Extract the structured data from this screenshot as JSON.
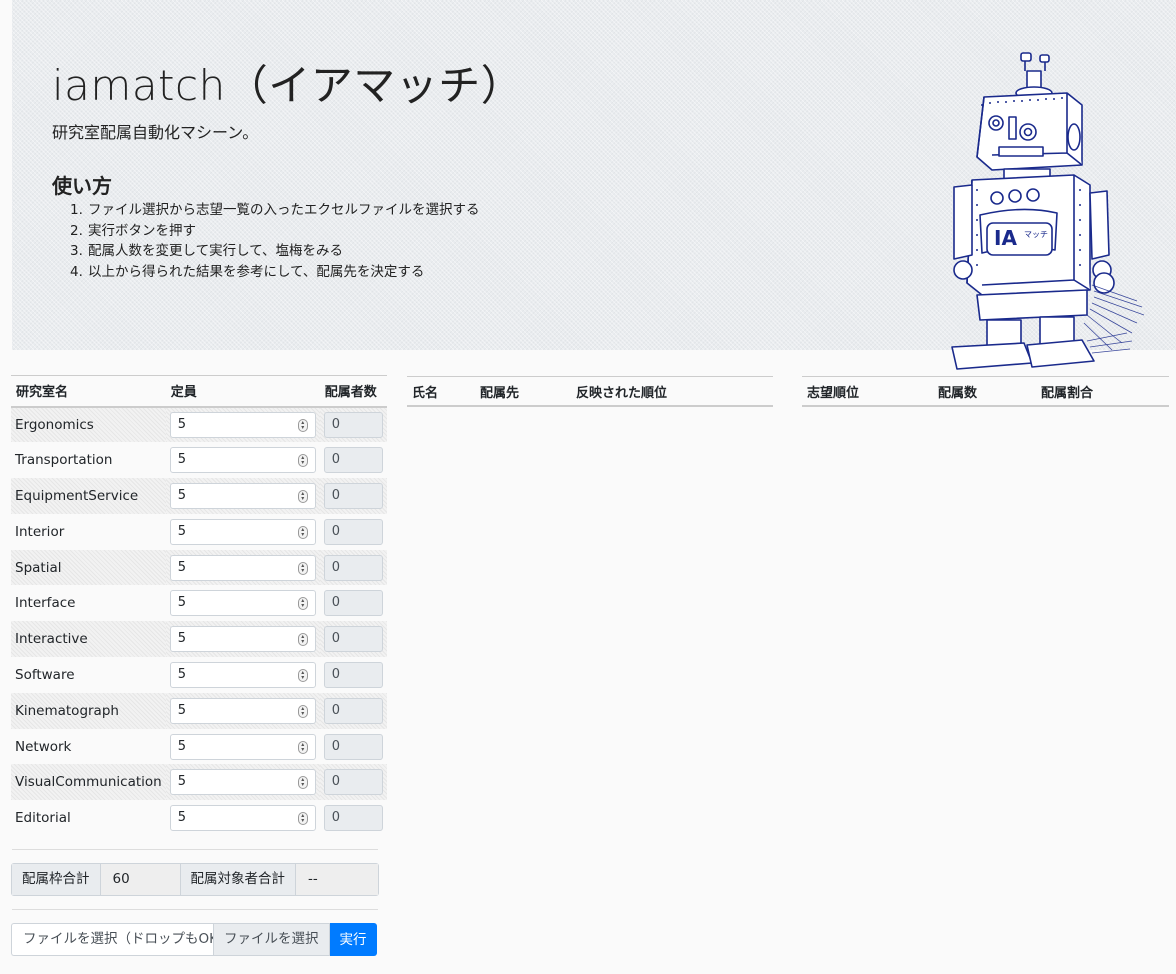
{
  "hero": {
    "title": "iamatch（イアマッチ）",
    "lead": "研究室配属自動化マシーン。",
    "howto_title": "使い方",
    "steps": [
      "ファイル選択から志望一覧の入ったエクセルファイルを選択する",
      "実行ボタンを押す",
      "配属人数を変更して実行して、塩梅をみる",
      "以上から得られた結果を参考にして、配属先を決定する"
    ],
    "robot_badge": "IA",
    "robot_badge_kana": "マッチ"
  },
  "labs_table": {
    "headers": [
      "研究室名",
      "定員",
      "配属者数"
    ],
    "rows": [
      {
        "name": "Ergonomics",
        "capacity": "5",
        "assigned": "0"
      },
      {
        "name": "Transportation",
        "capacity": "5",
        "assigned": "0"
      },
      {
        "name": "EquipmentService",
        "capacity": "5",
        "assigned": "0"
      },
      {
        "name": "Interior",
        "capacity": "5",
        "assigned": "0"
      },
      {
        "name": "Spatial",
        "capacity": "5",
        "assigned": "0"
      },
      {
        "name": "Interface",
        "capacity": "5",
        "assigned": "0"
      },
      {
        "name": "Interactive",
        "capacity": "5",
        "assigned": "0"
      },
      {
        "name": "Software",
        "capacity": "5",
        "assigned": "0"
      },
      {
        "name": "Kinematograph",
        "capacity": "5",
        "assigned": "0"
      },
      {
        "name": "Network",
        "capacity": "5",
        "assigned": "0"
      },
      {
        "name": "VisualCommunication",
        "capacity": "5",
        "assigned": "0"
      },
      {
        "name": "Editorial",
        "capacity": "5",
        "assigned": "0"
      }
    ]
  },
  "totals": {
    "capacity_label": "配属枠合計",
    "capacity_value": "60",
    "students_label": "配属対象者合計",
    "students_value": "--"
  },
  "file": {
    "placeholder": "ファイルを選択（ドロップもOK）",
    "browse_label": "ファイルを選択",
    "run_label": "実行"
  },
  "results_table": {
    "headers": [
      "氏名",
      "配属先",
      "反映された順位"
    ]
  },
  "stats_table": {
    "headers": [
      "志望順位",
      "配属数",
      "配属割合"
    ]
  },
  "colors": {
    "primary": "#007bff",
    "hero_bg": "#e9ecef",
    "robot_ink": "#1a2a8c"
  }
}
